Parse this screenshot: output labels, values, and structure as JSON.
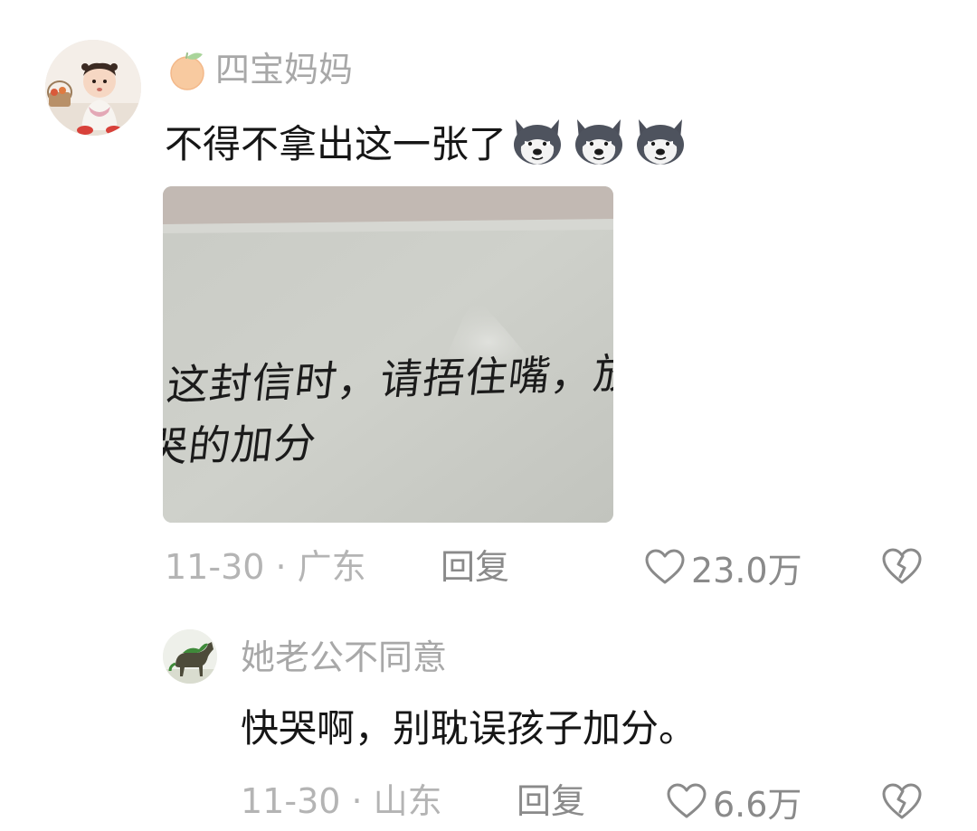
{
  "main_comment": {
    "username": "四宝妈妈",
    "badge_icon": "orange-fruit-icon",
    "text": "不得不拿出这一张了",
    "emojis": [
      "husky-dog-emoji",
      "husky-dog-emoji",
      "husky-dog-emoji"
    ],
    "image": {
      "handwriting_line1": "这封信时，请捂住嘴，放声哭",
      "handwriting_line2": "哭的加分"
    },
    "date": "11-30",
    "location": "广东",
    "date_location": "11-30 · 广东",
    "reply_label": "回复",
    "like_icon": "heart-outline-icon",
    "like_count": "23.0万",
    "dislike_icon": "broken-heart-icon"
  },
  "reply_comment": {
    "username": "她老公不同意",
    "text": "快哭啊，别耽误孩子加分。",
    "date": "11-30",
    "location": "山东",
    "date_location": "11-30 · 山东",
    "reply_label": "回复",
    "like_icon": "heart-outline-icon",
    "like_count": "6.6万",
    "dislike_icon": "broken-heart-icon"
  },
  "colors": {
    "username": "#a8a8a8",
    "body_text": "#161616",
    "meta_text": "#b4b4b4",
    "action_text": "#8a8a8a",
    "background": "#ffffff"
  }
}
